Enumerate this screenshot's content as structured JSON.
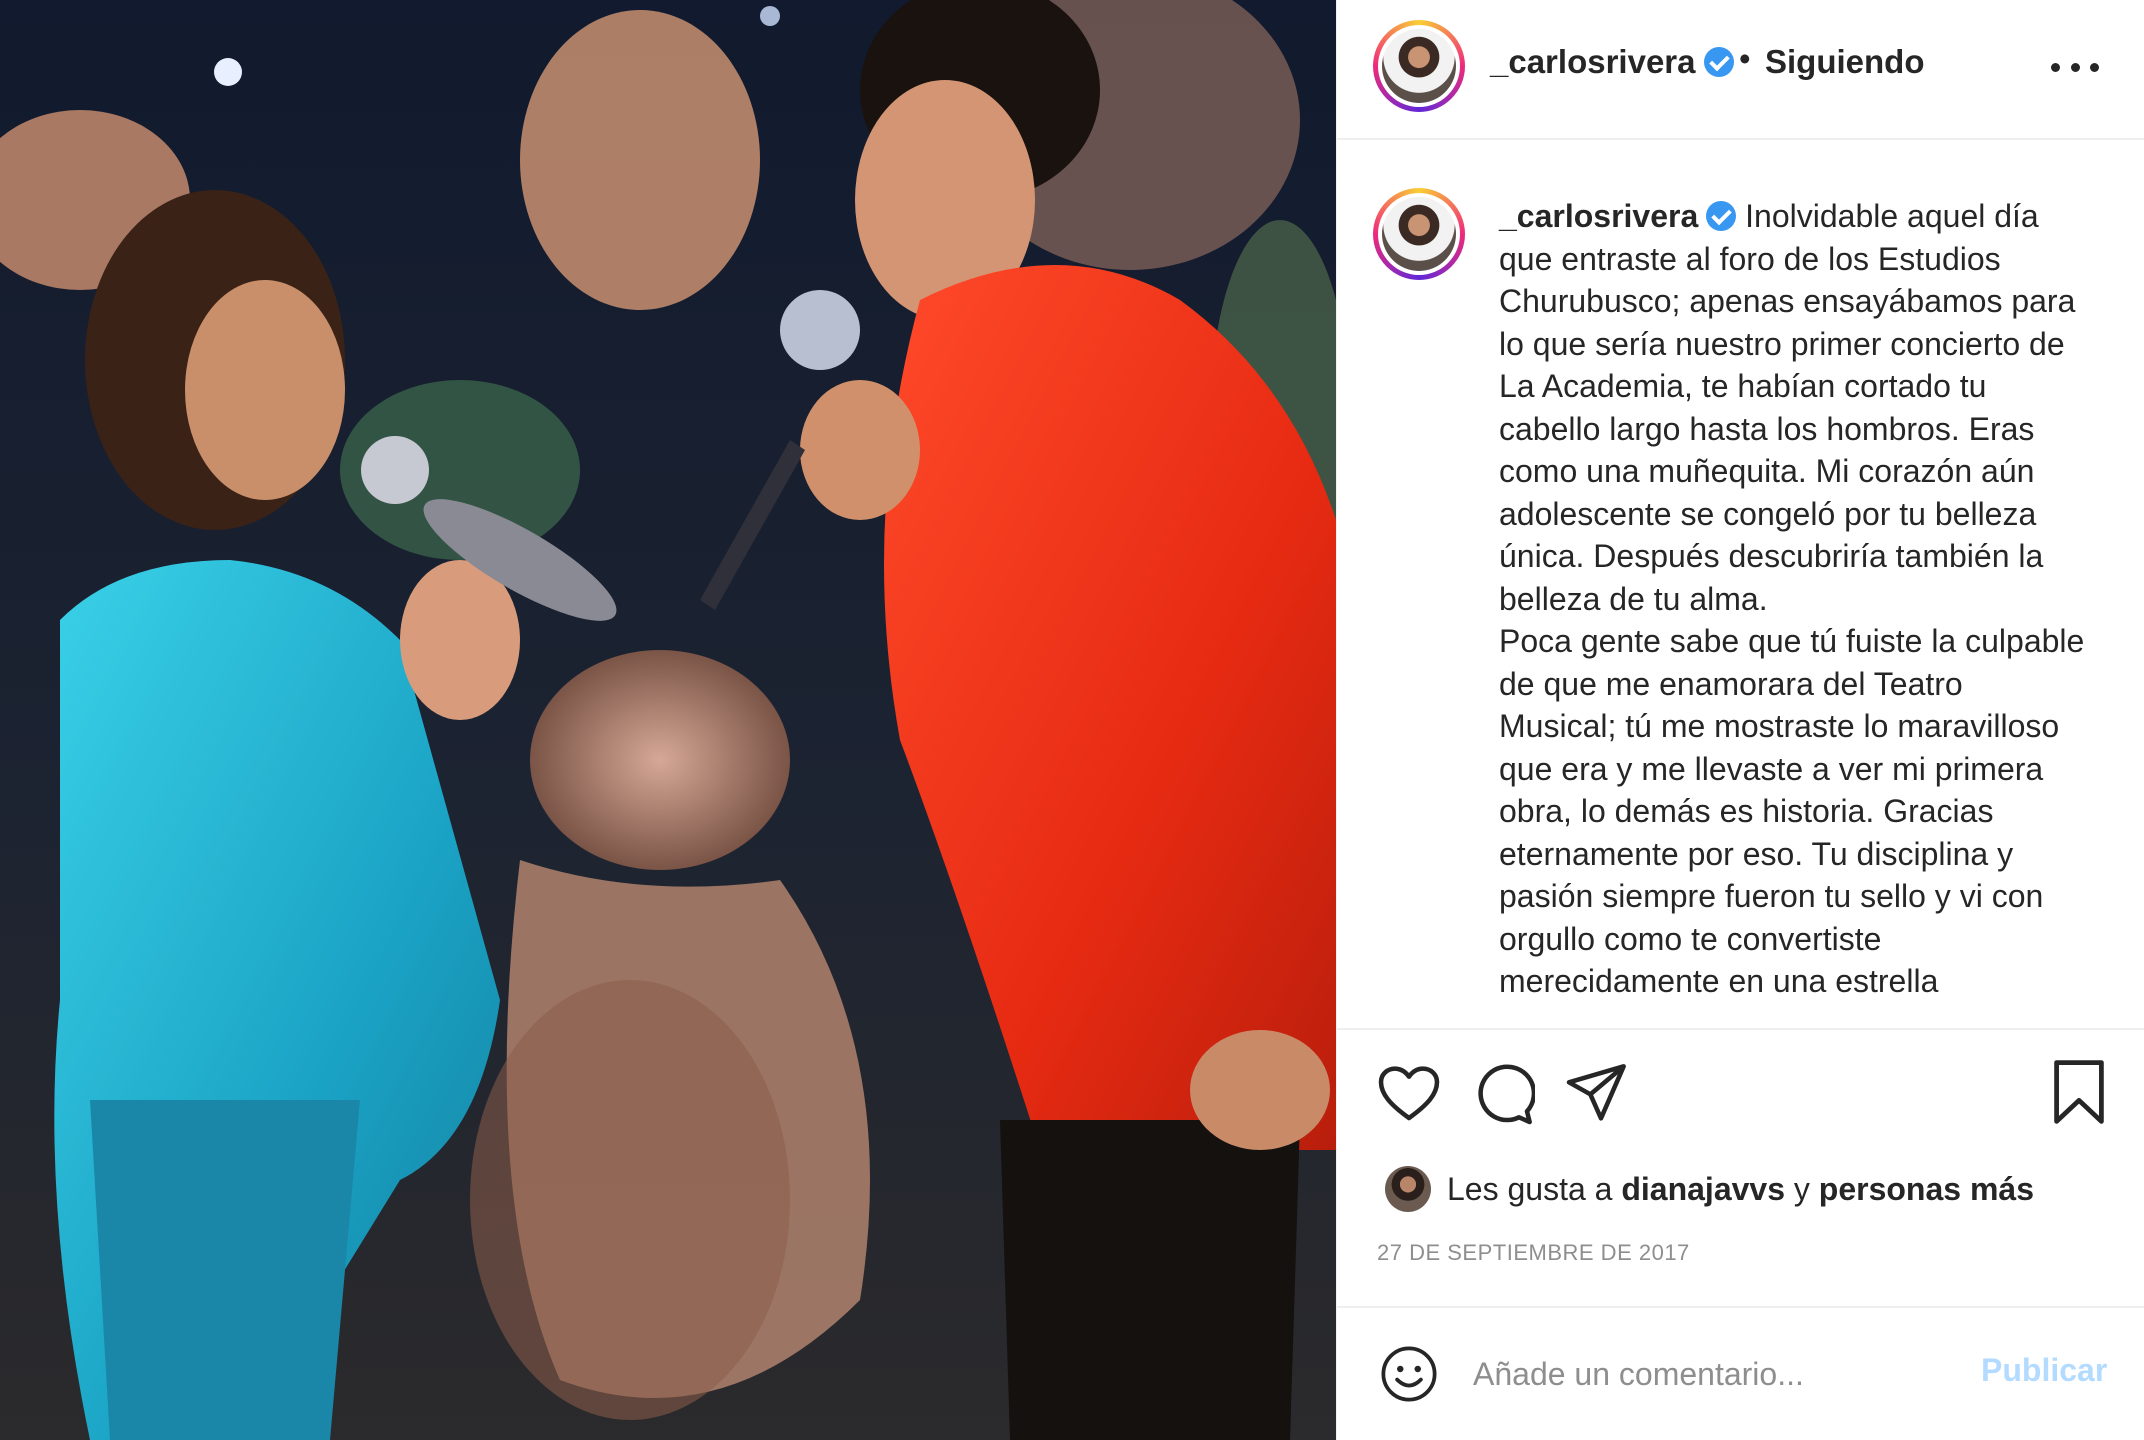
{
  "post": {
    "author": "_carlosrivera",
    "separator": "•",
    "follow_status": "Siguiendo",
    "caption_lines": [
      "Inolvidable aquel día",
      "que entraste al foro de los Estudios",
      "Churubusco; apenas ensayábamos para",
      "lo que sería nuestro primer concierto de",
      "La Academia, te habían cortado tu",
      "cabello largo hasta los hombros. Eras",
      "como una muñequita. Mi corazón aún",
      "adolescente se congeló por tu belleza",
      "única. Después descubriría también la",
      "belleza de tu alma.",
      "Poca gente sabe que tú fuiste la culpable",
      "de que me enamorara del Teatro",
      "Musical; tú me mostraste lo maravilloso",
      "que era y me llevaste a ver mi primera",
      "obra, lo demás es historia. Gracias",
      "eternamente por eso. Tu disciplina y",
      "pasión siempre fueron tu sello y vi con",
      "orgullo como te convertiste",
      "merecidamente en una estrella"
    ],
    "likes": {
      "prefix": "Les gusta a",
      "user": "dianajavvs",
      "connector": "y",
      "suffix": "personas más"
    },
    "date": "27 DE SEPTIEMBRE DE 2017",
    "comment_placeholder": "Añade un comentario...",
    "publish_label": "Publicar"
  },
  "colors": {
    "verified": "#3897f0",
    "publish_disabled": "#b3dbff",
    "muted": "#8e8e8e",
    "text": "#262626"
  },
  "icons": [
    "more-options-icon",
    "verified-badge-icon",
    "heart-icon",
    "comment-icon",
    "share-icon",
    "bookmark-icon",
    "emoji-icon"
  ]
}
